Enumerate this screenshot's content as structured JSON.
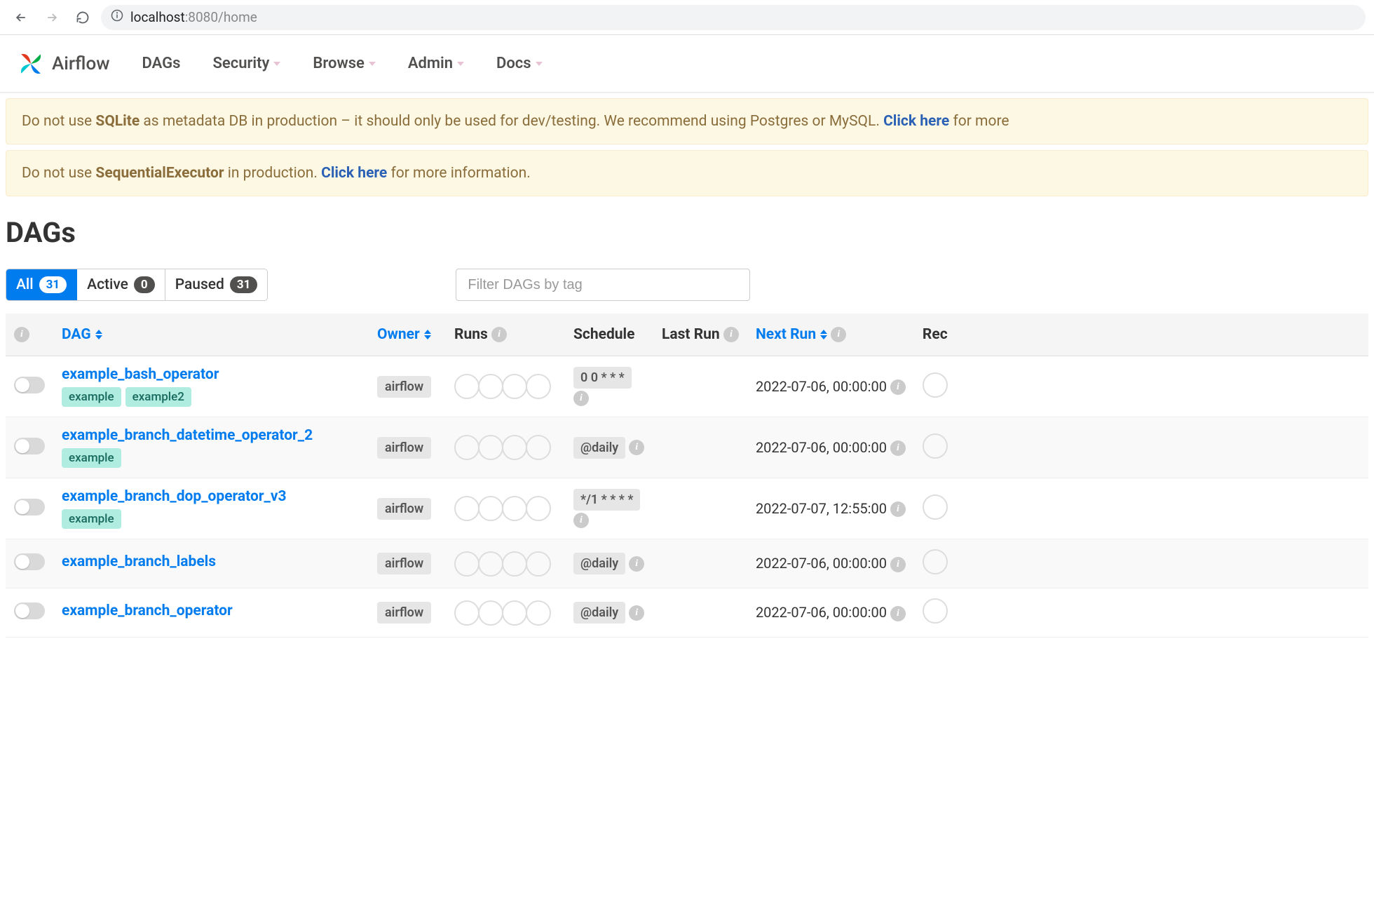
{
  "browser": {
    "url_prefix": "localhost",
    "url_suffix": ":8080/home"
  },
  "nav": {
    "app_name": "Airflow",
    "items": [
      "DAGs",
      "Security",
      "Browse",
      "Admin",
      "Docs"
    ]
  },
  "alerts": [
    {
      "pre": "Do not use ",
      "strong": "SQLite",
      "mid": " as metadata DB in production – it should only be used for dev/testing. We recommend using Postgres or MySQL. ",
      "link": "Click here",
      "post": " for more"
    },
    {
      "pre": "Do not use ",
      "strong": "SequentialExecutor",
      "mid": " in production. ",
      "link": "Click here",
      "post": " for more information."
    }
  ],
  "page_title": "DAGs",
  "filters": {
    "all": {
      "label": "All",
      "count": "31"
    },
    "active": {
      "label": "Active",
      "count": "0"
    },
    "paused": {
      "label": "Paused",
      "count": "31"
    }
  },
  "filter_tag_placeholder": "Filter DAGs by tag",
  "columns": {
    "dag": "DAG",
    "owner": "Owner",
    "runs": "Runs",
    "schedule": "Schedule",
    "last_run": "Last Run",
    "next_run": "Next Run",
    "recent": "Rec"
  },
  "dags": [
    {
      "name": "example_bash_operator",
      "tags": [
        "example",
        "example2"
      ],
      "owner": "airflow",
      "schedule": "0 0 * * *",
      "next_run": "2022-07-06, 00:00:00"
    },
    {
      "name": "example_branch_datetime_operator_2",
      "tags": [
        "example"
      ],
      "owner": "airflow",
      "schedule": "@daily",
      "next_run": "2022-07-06, 00:00:00"
    },
    {
      "name": "example_branch_dop_operator_v3",
      "tags": [
        "example"
      ],
      "owner": "airflow",
      "schedule": "*/1 * * * *",
      "next_run": "2022-07-07, 12:55:00"
    },
    {
      "name": "example_branch_labels",
      "tags": [],
      "owner": "airflow",
      "schedule": "@daily",
      "next_run": "2022-07-06, 00:00:00"
    },
    {
      "name": "example_branch_operator",
      "tags": [],
      "owner": "airflow",
      "schedule": "@daily",
      "next_run": "2022-07-06, 00:00:00"
    }
  ]
}
